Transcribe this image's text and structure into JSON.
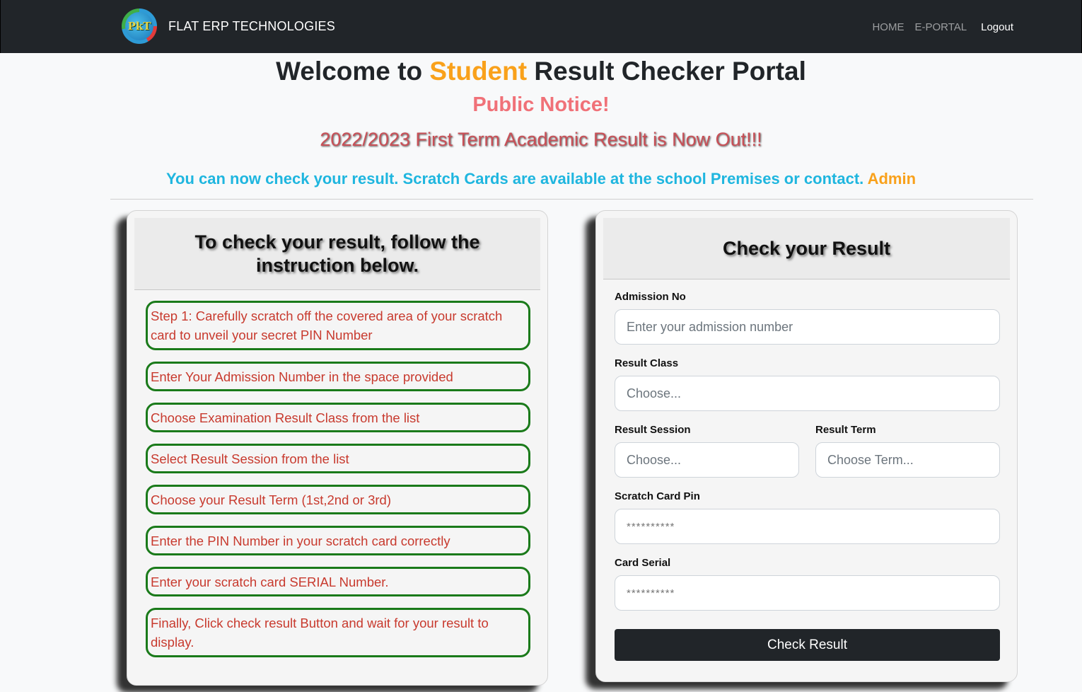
{
  "navbar": {
    "logo_text": "PkT",
    "brand": "FLAT ERP TECHNOLOGIES",
    "links": [
      "HOME",
      "E-PORTAL"
    ],
    "logout": "Logout"
  },
  "hero": {
    "welcome_prefix": "Welcome to ",
    "welcome_accent": "Student",
    "welcome_suffix": " Result Checker Portal",
    "notice": "Public Notice!",
    "announcement": "2022/2023 First Term Academic Result is Now Out!!!",
    "info_text": "You can now check your result. Scratch Cards are available at the school Premises or contact. ",
    "info_link": "Admin"
  },
  "instructions": {
    "title": "To check your result, follow the instruction below.",
    "steps": [
      "Step 1: Carefully scratch off the covered area of your scratch card to unveil your secret PIN Number",
      "Enter Your Admission Number in the space provided",
      "Choose Examination Result Class from the list",
      "Select Result Session from the list",
      "Choose your Result Term (1st,2nd or 3rd)",
      "Enter the PIN Number in your scratch card correctly",
      "Enter your scratch card SERIAL Number.",
      "Finally, Click check result Button and wait for your result to display."
    ]
  },
  "form": {
    "title": "Check your Result",
    "admission_label": "Admission No",
    "admission_placeholder": "Enter your admission number",
    "class_label": "Result Class",
    "class_value": "Choose...",
    "session_label": "Result Session",
    "session_value": "Choose...",
    "term_label": "Result Term",
    "term_value": "Choose Term...",
    "pin_label": "Scratch Card Pin",
    "pin_placeholder": "**********",
    "serial_label": "Card Serial",
    "serial_placeholder": "**********",
    "submit": "Check Result"
  },
  "colors": {
    "accent": "#f9a11b",
    "notice": "#f07178",
    "info": "#1fb6df",
    "step_border": "#1a7a1a",
    "step_text": "#c83a2e",
    "navbar": "#212529"
  }
}
